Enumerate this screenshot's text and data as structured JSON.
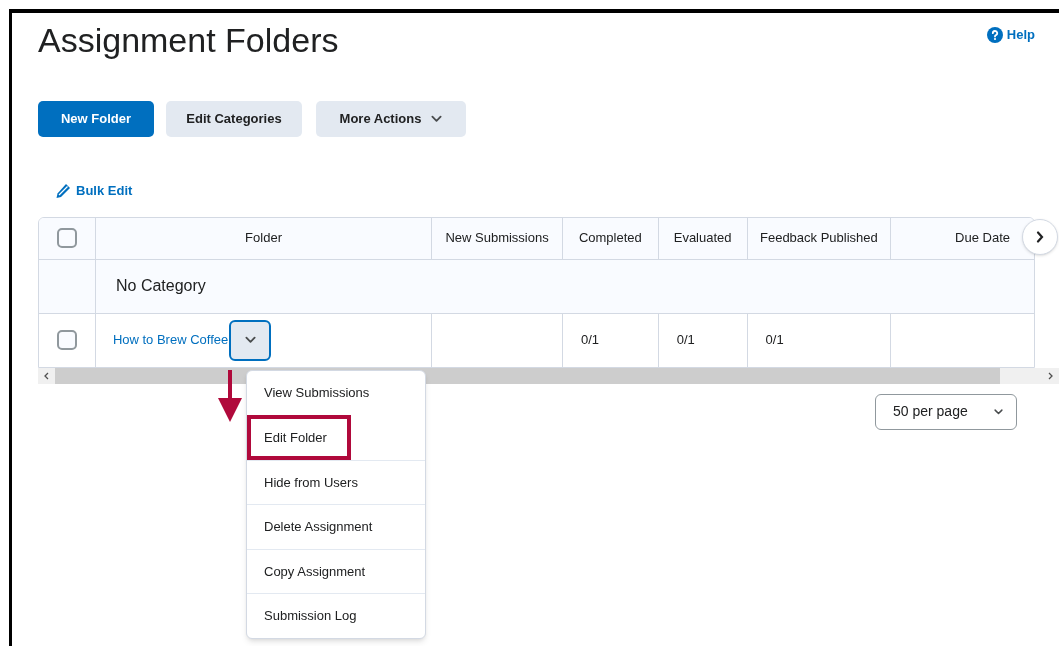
{
  "title": "Assignment Folders",
  "help": {
    "label": "Help"
  },
  "toolbar": [
    {
      "label": "New Folder",
      "kind": "primary"
    },
    {
      "label": "Edit Categories",
      "kind": "secondary"
    },
    {
      "label": "More Actions",
      "kind": "dropdown"
    }
  ],
  "bulk_edit": {
    "label": "Bulk Edit"
  },
  "table": {
    "select_all": {
      "checked": false
    },
    "columns": [
      "Folder",
      "New Submissions",
      "Completed",
      "Evaluated",
      "Feedback Published",
      "Due Date"
    ],
    "category": "No Category",
    "rows": [
      {
        "checked": false,
        "cells": [
          "How to Brew Coffee",
          "",
          "0/1",
          "0/1",
          "0/1",
          ""
        ]
      }
    ]
  },
  "context_menu": {
    "items": [
      {
        "label": "View Submissions",
        "highlighted": false
      },
      {
        "label": "Edit Folder",
        "highlighted": true
      },
      {
        "label": "Hide from Users",
        "highlighted": false
      },
      {
        "label": "Delete Assignment",
        "highlighted": false
      },
      {
        "label": "Copy Assignment",
        "highlighted": false
      },
      {
        "label": "Submission Log",
        "highlighted": false
      }
    ]
  },
  "page_size": {
    "value": "50 per page"
  }
}
